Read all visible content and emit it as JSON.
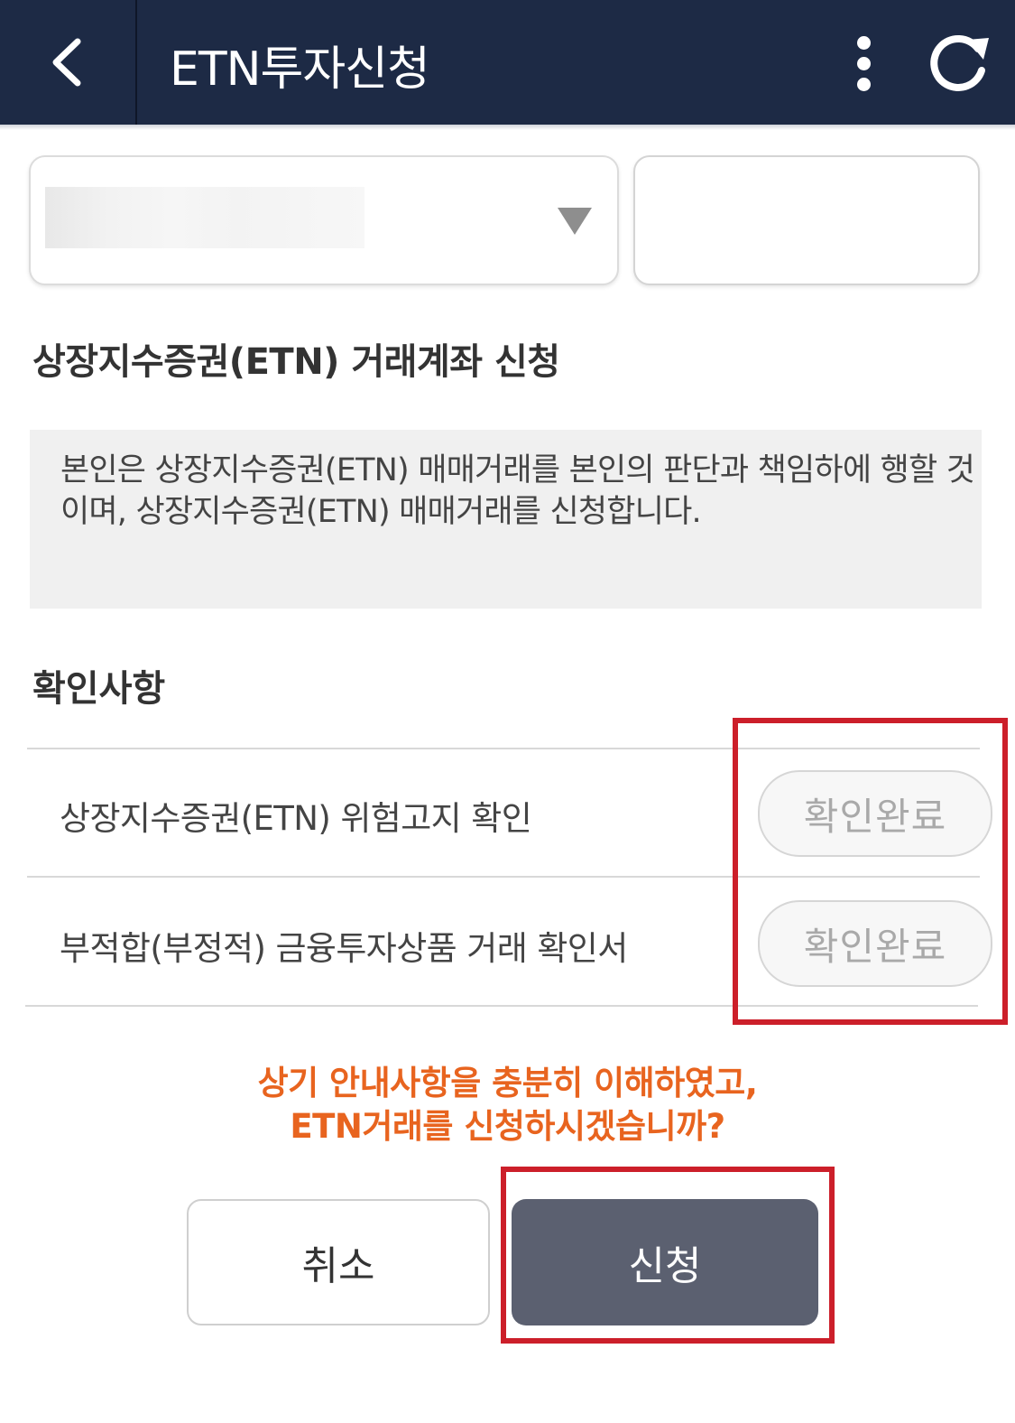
{
  "header": {
    "title": "ETN투자신청",
    "back_icon": "chevron-left-icon",
    "more_icon": "vertical-dots-icon",
    "refresh_icon": "refresh-icon",
    "background_color": "#1d2a45"
  },
  "account": {
    "select_icon": "dropdown-triangle-icon"
  },
  "section": {
    "title": "상장지수증권(ETN) 거래계좌 신청",
    "notice_text": "본인은 상장지수증권(ETN) 매매거래를 본인의 판단과 책임하에 행할 것이며, 상장지수증권(ETN) 매매거래를 신청합니다."
  },
  "confirmations": {
    "title": "확인사항",
    "items": [
      {
        "label": "상장지수증권(ETN) 위험고지 확인",
        "status": "확인완료"
      },
      {
        "label": "부적합(부정적) 금융투자상품 거래 확인서",
        "status": "확인완료"
      }
    ]
  },
  "prompt": {
    "line1": "상기 안내사항을 충분히 이해하였고,",
    "line2": "ETN거래를 신청하시겠습니까?",
    "color": "#e8641f"
  },
  "actions": {
    "cancel_label": "취소",
    "submit_label": "신청",
    "submit_color": "#5b6070"
  },
  "highlight_color": "#cc1f2a"
}
